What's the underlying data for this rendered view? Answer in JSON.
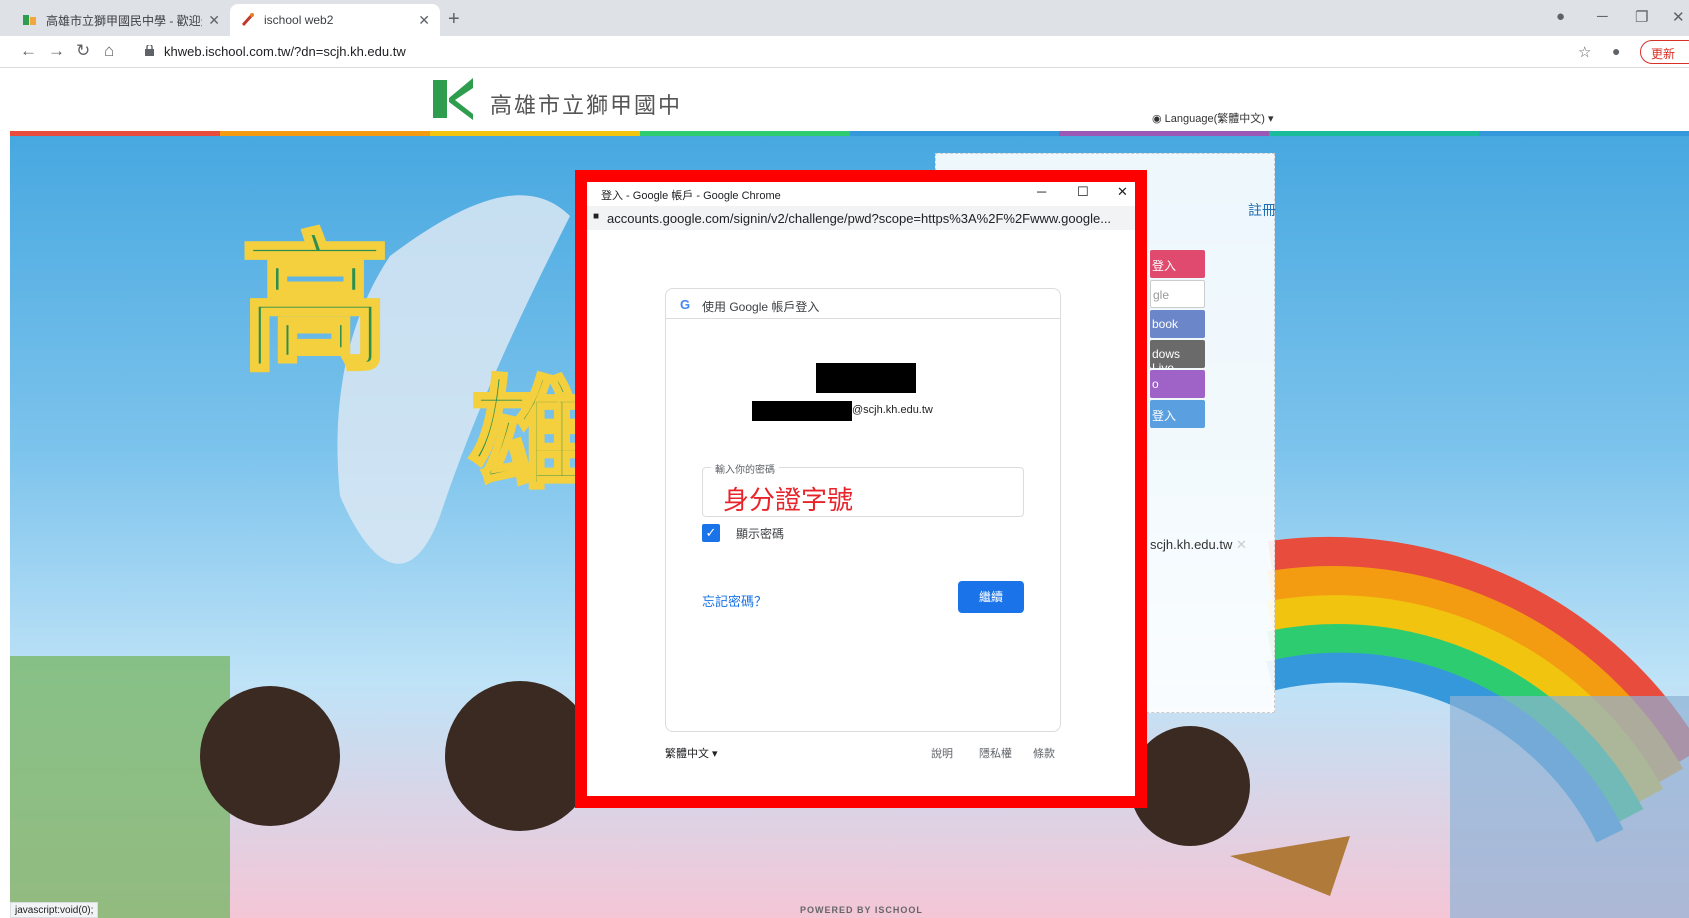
{
  "browser": {
    "tabs": [
      {
        "title": "高雄市立獅甲國民中學 - 歡迎光臨",
        "active": false
      },
      {
        "title": "ischool web2",
        "active": true
      }
    ],
    "new_tab_label": "+",
    "address": "khweb.ischool.com.tw/?dn=scjh.kh.edu.tw",
    "update_label": "更新"
  },
  "site": {
    "title": "高雄市立獅甲國中",
    "language_label": "Language(繁體中文)",
    "register_label": "註冊",
    "login_buttons": [
      {
        "label": "登入",
        "color": "#e04a6f"
      },
      {
        "label": "gle",
        "color": "#ffffff"
      },
      {
        "label": "book",
        "color": "#6b86c9"
      },
      {
        "label": "dows Live",
        "color": "#6a6a6a"
      },
      {
        "label": "o",
        "color": "#9f62c7"
      },
      {
        "label": "登入",
        "color": "#5a9fe0"
      }
    ],
    "email_suffix": "scjh.kh.edu.tw",
    "powered_by": "POWERED BY ISCHOOL",
    "colorbar": [
      "#e74c3c",
      "#f39c12",
      "#f1c40f",
      "#2ecc71",
      "#3498db",
      "#9b59b6",
      "#e74c3c",
      "#3498db"
    ]
  },
  "popup": {
    "window_title": "登入 - Google 帳戶 - Google Chrome",
    "url": "accounts.google.com/signin/v2/challenge/pwd?scope=https%3A%2F%2Fwww.google...",
    "card_header": "使用 Google 帳戶登入",
    "email_domain": "@scjh.kh.edu.tw",
    "password_label": "輸入你的密碼",
    "password_value": "身分證字號",
    "show_password_label": "顯示密碼",
    "forgot_label": "忘記密碼？",
    "next_label": "繼續",
    "footer_language": "繁體中文",
    "footer_help": "說明",
    "footer_privacy": "隱私權",
    "footer_terms": "條款"
  },
  "status_bar": "javascript:void(0);"
}
